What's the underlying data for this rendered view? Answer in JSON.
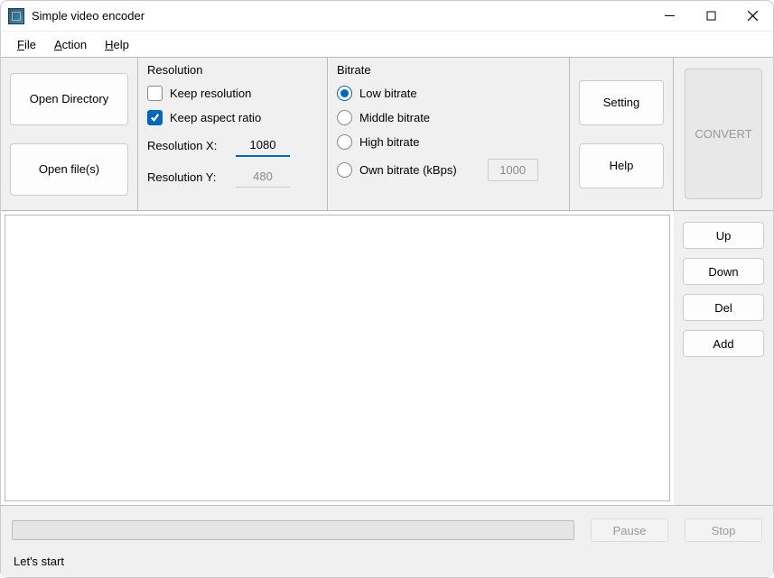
{
  "titlebar": {
    "title": "Simple video encoder"
  },
  "menu": {
    "file": "File",
    "action": "Action",
    "help": "Help"
  },
  "open": {
    "open_dir": "Open Directory",
    "open_files": "Open file(s)"
  },
  "resolution": {
    "title": "Resolution",
    "keep_resolution_label": "Keep resolution",
    "keep_resolution_checked": false,
    "keep_aspect_label": "Keep aspect ratio",
    "keep_aspect_checked": true,
    "x_label": "Resolution X:",
    "x_value": "1080",
    "y_label": "Resolution Y:",
    "y_value": "480"
  },
  "bitrate": {
    "title": "Bitrate",
    "low": "Low bitrate",
    "middle": "Middle bitrate",
    "high": "High bitrate",
    "own": "Own bitrate (kBps)",
    "own_value": "1000",
    "selected": "low"
  },
  "side": {
    "setting": "Setting",
    "help": "Help"
  },
  "convert": {
    "label": "CONVERT"
  },
  "list_buttons": {
    "up": "Up",
    "down": "Down",
    "del": "Del",
    "add": "Add"
  },
  "bottom": {
    "pause": "Pause",
    "stop": "Stop"
  },
  "status": {
    "text": "Let's start"
  }
}
